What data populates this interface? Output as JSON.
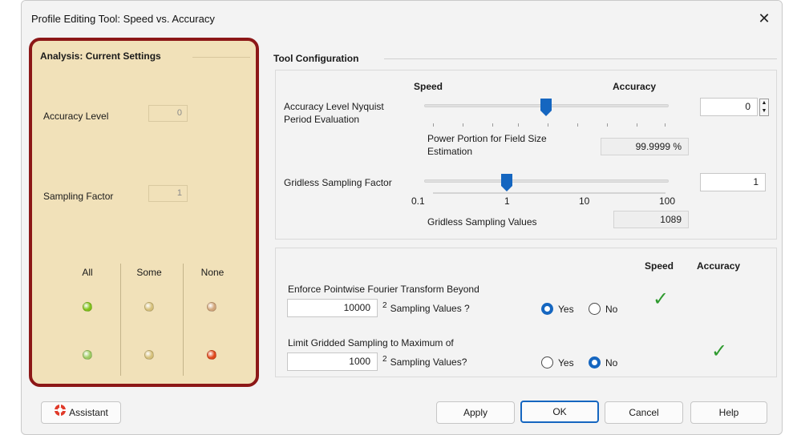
{
  "window": {
    "title": "Profile Editing Tool: Speed vs. Accuracy"
  },
  "analysis": {
    "title": "Analysis: Current Settings",
    "accuracy_label": "Accuracy Level",
    "accuracy_value": "0",
    "sampling_label": "Sampling Factor",
    "sampling_value": "1",
    "columns": [
      "All",
      "Some",
      "None"
    ],
    "indicators": [
      [
        "#82c21a",
        "#d6c07a",
        "#d2a67a"
      ],
      [
        "#9ecb62",
        "#d6c07a",
        "#e0481c"
      ]
    ]
  },
  "config": {
    "title": "Tool Configuration",
    "speed_header": "Speed",
    "accuracy_header": "Accuracy",
    "nyquist_label_1": "Accuracy Level Nyquist",
    "nyquist_label_2": "Period Evaluation",
    "nyquist_value": "0",
    "power_label_1": "Power Portion for Field Size",
    "power_label_2": "Estimation",
    "power_value": "99.9999 %",
    "gridless_label": "Gridless Sampling Factor",
    "gridless_value": "1",
    "scale_labels": [
      "0.1",
      "1",
      "10",
      "100"
    ],
    "gridless_values_label": "Gridless Sampling Values",
    "gridless_values_value": "1089"
  },
  "options": {
    "speed_header": "Speed",
    "accuracy_header": "Accuracy",
    "fourier_label": "Enforce Pointwise Fourier Transform Beyond",
    "fourier_value": "10000",
    "fourier_suffix": "Sampling Values ?",
    "limit_label": "Limit Gridded Sampling to Maximum of",
    "limit_value": "1000",
    "limit_suffix": "Sampling Values?",
    "exponent": "2",
    "yes": "Yes",
    "no": "No",
    "check_mark": "✓"
  },
  "buttons": {
    "assistant": "Assistant",
    "apply": "Apply",
    "ok": "OK",
    "cancel": "Cancel",
    "help": "Help"
  },
  "colors": {
    "accent": "#1566c0",
    "highlight_border": "#8c1717",
    "check": "#2e9a2e"
  }
}
